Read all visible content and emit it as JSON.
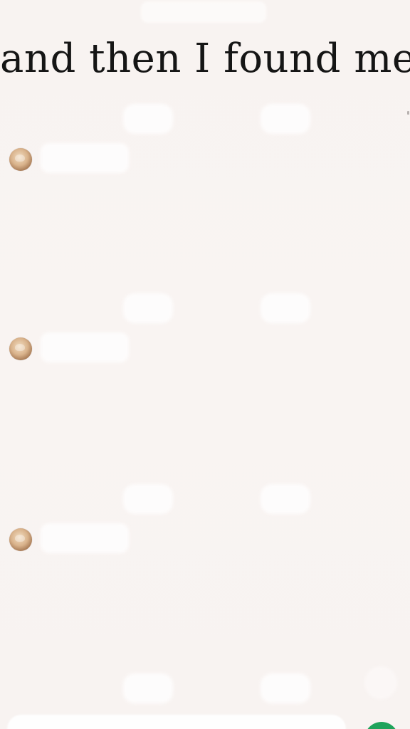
{
  "caption": {
    "text": "and then I found me"
  },
  "chat": {
    "row_count": 4,
    "rows": [
      {
        "id": 1
      },
      {
        "id": 2
      },
      {
        "id": 3
      },
      {
        "id": 4
      }
    ]
  },
  "composer": {
    "send_button_color": "#1fa35b"
  },
  "colors": {
    "background": "#f8f3f1",
    "caption_text": "#151515",
    "bubble": "#fefdfd",
    "accent_green": "#1fa35b"
  },
  "icons": {
    "avatar": "avatar-icon",
    "send": "send-icon"
  }
}
